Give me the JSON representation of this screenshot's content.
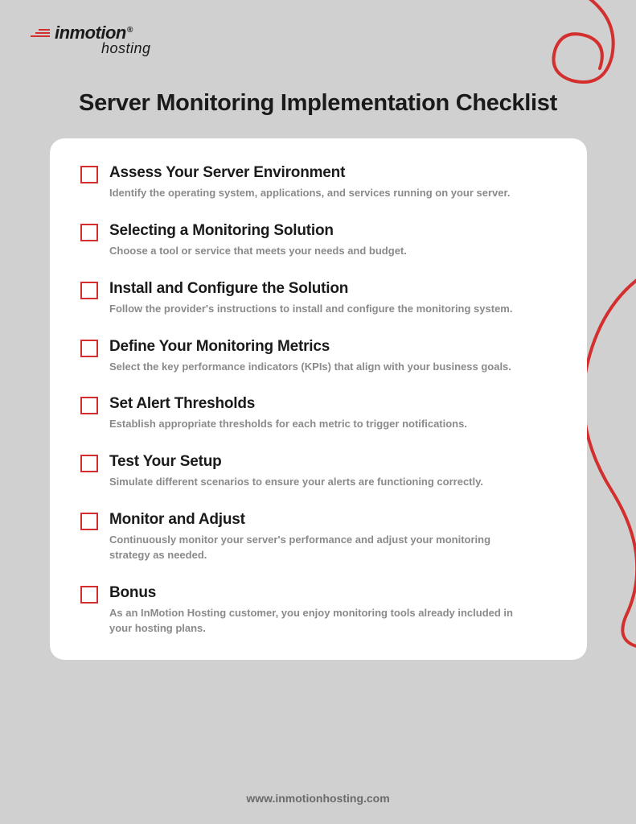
{
  "logo": {
    "main": "inmotion",
    "sub": "hosting"
  },
  "title": "Server Monitoring Implementation Checklist",
  "checklist": [
    {
      "title": "Assess Your Server Environment",
      "desc": "Identify the operating system, applications, and services running on your server."
    },
    {
      "title": "Selecting a Monitoring Solution",
      "desc": "Choose a tool or service that meets your needs and budget."
    },
    {
      "title": "Install and Configure the Solution",
      "desc": "Follow the provider's instructions to install and configure the monitoring system."
    },
    {
      "title": "Define Your Monitoring Metrics",
      "desc": "Select the key performance indicators (KPIs) that align with your business goals."
    },
    {
      "title": "Set Alert Thresholds",
      "desc": "Establish appropriate thresholds for each metric to trigger notifications."
    },
    {
      "title": "Test Your Setup",
      "desc": "Simulate different scenarios to ensure your alerts are functioning correctly."
    },
    {
      "title": "Monitor and Adjust",
      "desc": "Continuously monitor your server's performance and adjust your monitoring strategy as needed."
    },
    {
      "title": "Bonus",
      "desc": "As an InMotion Hosting customer, you enjoy monitoring tools already included in your hosting plans."
    }
  ],
  "footer": "www.inmotionhosting.com"
}
